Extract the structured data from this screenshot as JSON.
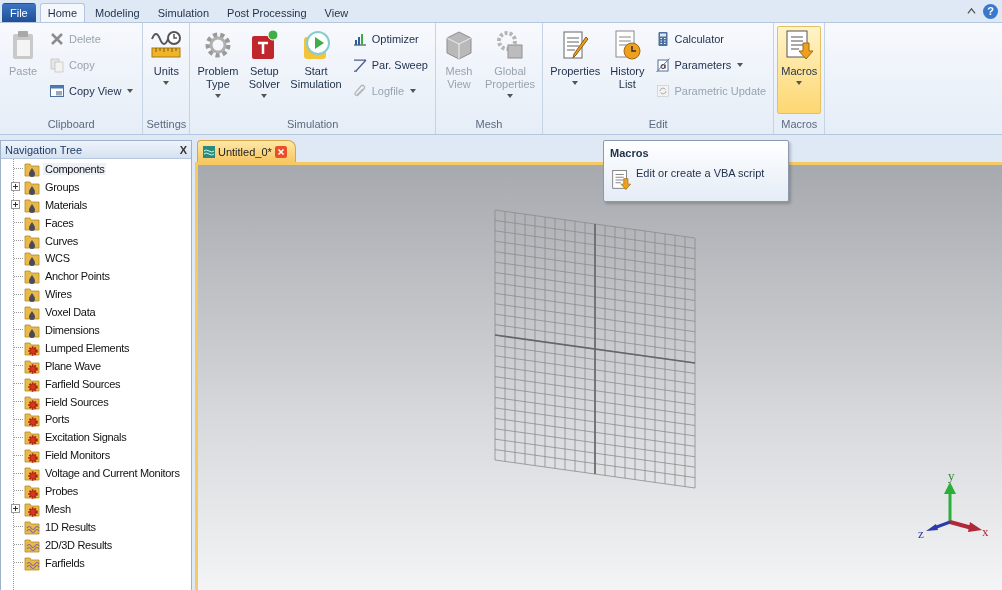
{
  "ribbon_tabs": [
    {
      "label": "File",
      "kind": "file",
      "selected": false
    },
    {
      "label": "Home",
      "kind": "tab",
      "selected": true
    },
    {
      "label": "Modeling",
      "kind": "tab",
      "selected": false
    },
    {
      "label": "Simulation",
      "kind": "tab",
      "selected": false
    },
    {
      "label": "Post Processing",
      "kind": "tab",
      "selected": false
    },
    {
      "label": "View",
      "kind": "tab",
      "selected": false
    }
  ],
  "help_button": "?",
  "ribbon_groups": [
    {
      "label": "Clipboard",
      "buttons": [
        {
          "kind": "large",
          "lines": [
            "Paste"
          ],
          "disabled": true,
          "dropdown": false,
          "highlighted": false
        },
        {
          "kind": "small",
          "lines": [
            "Delete"
          ],
          "disabled": true,
          "dropdown": false,
          "highlighted": false
        },
        {
          "kind": "small",
          "lines": [
            "Copy"
          ],
          "disabled": true,
          "dropdown": false,
          "highlighted": false
        },
        {
          "kind": "small",
          "lines": [
            "Copy View"
          ],
          "disabled": false,
          "dropdown": true,
          "highlighted": false
        }
      ]
    },
    {
      "label": "Settings",
      "buttons": [
        {
          "kind": "large",
          "lines": [
            "Units"
          ],
          "disabled": false,
          "dropdown": true,
          "highlighted": false
        }
      ]
    },
    {
      "label": "Simulation",
      "buttons": [
        {
          "kind": "large",
          "lines": [
            "Problem",
            "Type"
          ],
          "disabled": false,
          "dropdown": true,
          "highlighted": false
        },
        {
          "kind": "large",
          "lines": [
            "Setup",
            "Solver"
          ],
          "disabled": false,
          "dropdown": true,
          "highlighted": false
        },
        {
          "kind": "large",
          "lines": [
            "Start",
            "Simulation"
          ],
          "disabled": false,
          "dropdown": false,
          "highlighted": false
        },
        {
          "kind": "small",
          "lines": [
            "Optimizer"
          ],
          "disabled": false,
          "dropdown": false,
          "highlighted": false
        },
        {
          "kind": "small",
          "lines": [
            "Par. Sweep"
          ],
          "disabled": false,
          "dropdown": false,
          "highlighted": false
        },
        {
          "kind": "small",
          "lines": [
            "Logfile"
          ],
          "disabled": true,
          "dropdown": true,
          "highlighted": false
        }
      ]
    },
    {
      "label": "Mesh",
      "buttons": [
        {
          "kind": "large",
          "lines": [
            "Mesh",
            "View"
          ],
          "disabled": true,
          "dropdown": false,
          "highlighted": false
        },
        {
          "kind": "large",
          "lines": [
            "Global",
            "Properties"
          ],
          "disabled": true,
          "dropdown": true,
          "highlighted": false
        }
      ]
    },
    {
      "label": "Edit",
      "buttons": [
        {
          "kind": "large",
          "lines": [
            "Properties"
          ],
          "disabled": false,
          "dropdown": true,
          "highlighted": false
        },
        {
          "kind": "large",
          "lines": [
            "History",
            "List"
          ],
          "disabled": false,
          "dropdown": false,
          "highlighted": false
        },
        {
          "kind": "small",
          "lines": [
            "Calculator"
          ],
          "disabled": false,
          "dropdown": false,
          "highlighted": false
        },
        {
          "kind": "small",
          "lines": [
            "Parameters"
          ],
          "disabled": false,
          "dropdown": true,
          "highlighted": false
        },
        {
          "kind": "small",
          "lines": [
            "Parametric Update"
          ],
          "disabled": true,
          "dropdown": false,
          "highlighted": false
        }
      ]
    },
    {
      "label": "Macros",
      "buttons": [
        {
          "kind": "large",
          "lines": [
            "Macros"
          ],
          "disabled": false,
          "dropdown": true,
          "highlighted": true
        }
      ]
    }
  ],
  "navigation_tree": {
    "title": "Navigation Tree",
    "close": "X",
    "items": [
      {
        "label": "Components",
        "kind": "folder",
        "expandable": false,
        "selected": true
      },
      {
        "label": "Groups",
        "kind": "folder",
        "expandable": true,
        "selected": false
      },
      {
        "label": "Materials",
        "kind": "folder",
        "expandable": true,
        "selected": false
      },
      {
        "label": "Faces",
        "kind": "folder",
        "expandable": false,
        "selected": false
      },
      {
        "label": "Curves",
        "kind": "folder",
        "expandable": false,
        "selected": false
      },
      {
        "label": "WCS",
        "kind": "folder",
        "expandable": false,
        "selected": false
      },
      {
        "label": "Anchor Points",
        "kind": "folder",
        "expandable": false,
        "selected": false
      },
      {
        "label": "Wires",
        "kind": "folder",
        "expandable": false,
        "selected": false
      },
      {
        "label": "Voxel Data",
        "kind": "folder",
        "expandable": false,
        "selected": false
      },
      {
        "label": "Dimensions",
        "kind": "folder",
        "expandable": false,
        "selected": false
      },
      {
        "label": "Lumped Elements",
        "kind": "source",
        "expandable": false,
        "selected": false
      },
      {
        "label": "Plane Wave",
        "kind": "source",
        "expandable": false,
        "selected": false
      },
      {
        "label": "Farfield Sources",
        "kind": "source",
        "expandable": false,
        "selected": false
      },
      {
        "label": "Field Sources",
        "kind": "source",
        "expandable": false,
        "selected": false
      },
      {
        "label": "Ports",
        "kind": "source",
        "expandable": false,
        "selected": false
      },
      {
        "label": "Excitation Signals",
        "kind": "source",
        "expandable": false,
        "selected": false
      },
      {
        "label": "Field Monitors",
        "kind": "source",
        "expandable": false,
        "selected": false
      },
      {
        "label": "Voltage and Current Monitors",
        "kind": "source",
        "expandable": false,
        "selected": false
      },
      {
        "label": "Probes",
        "kind": "source",
        "expandable": false,
        "selected": false
      },
      {
        "label": "Mesh",
        "kind": "source",
        "expandable": true,
        "selected": false
      },
      {
        "label": "1D Results",
        "kind": "result",
        "expandable": false,
        "selected": false
      },
      {
        "label": "2D/3D Results",
        "kind": "result",
        "expandable": false,
        "selected": false
      },
      {
        "label": "Farfields",
        "kind": "result",
        "expandable": false,
        "selected": false
      }
    ]
  },
  "document_tab": {
    "label": "Untitled_0*",
    "selected": true
  },
  "axes": {
    "x": "x",
    "y": "y",
    "z": "z"
  },
  "tooltip": {
    "title": "Macros",
    "text": "Edit or create a VBA script"
  }
}
